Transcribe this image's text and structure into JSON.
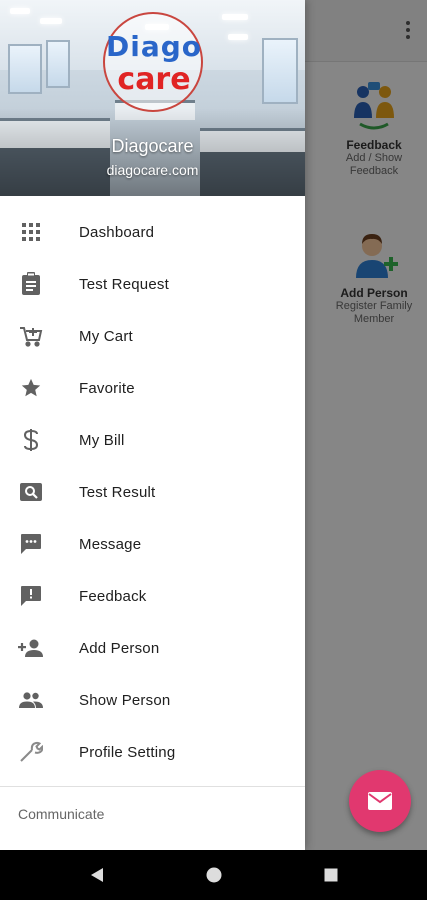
{
  "background": {
    "cards": [
      {
        "title": "Feedback",
        "subtitle": "Add / Show Feedback"
      },
      {
        "title": "Add Person",
        "subtitle": "Register Family Member"
      }
    ]
  },
  "drawer": {
    "header": {
      "logo_line1": "Diago",
      "logo_line2": "care",
      "name": "Diagocare",
      "email": "diagocare.com"
    },
    "menu": [
      {
        "label": "Dashboard",
        "icon": "grid-icon"
      },
      {
        "label": "Test Request",
        "icon": "clipboard-icon"
      },
      {
        "label": "My Cart",
        "icon": "cart-add-icon"
      },
      {
        "label": "Favorite",
        "icon": "star-icon"
      },
      {
        "label": "My Bill",
        "icon": "dollar-icon"
      },
      {
        "label": "Test Result",
        "icon": "image-search-icon"
      },
      {
        "label": "Message",
        "icon": "chat-icon"
      },
      {
        "label": "Feedback",
        "icon": "feedback-icon"
      },
      {
        "label": "Add Person",
        "icon": "person-add-icon"
      },
      {
        "label": "Show Person",
        "icon": "people-icon"
      },
      {
        "label": "Profile Setting",
        "icon": "wrench-icon"
      }
    ],
    "section_label": "Communicate"
  },
  "fab": {
    "icon": "mail-icon",
    "color": "#e1386f"
  },
  "colors": {
    "icon_gray": "#616161",
    "logo_blue": "#2a66c9",
    "logo_red": "#e02424"
  },
  "navbar": {
    "buttons": [
      "back-icon",
      "home-icon",
      "recents-icon"
    ]
  }
}
